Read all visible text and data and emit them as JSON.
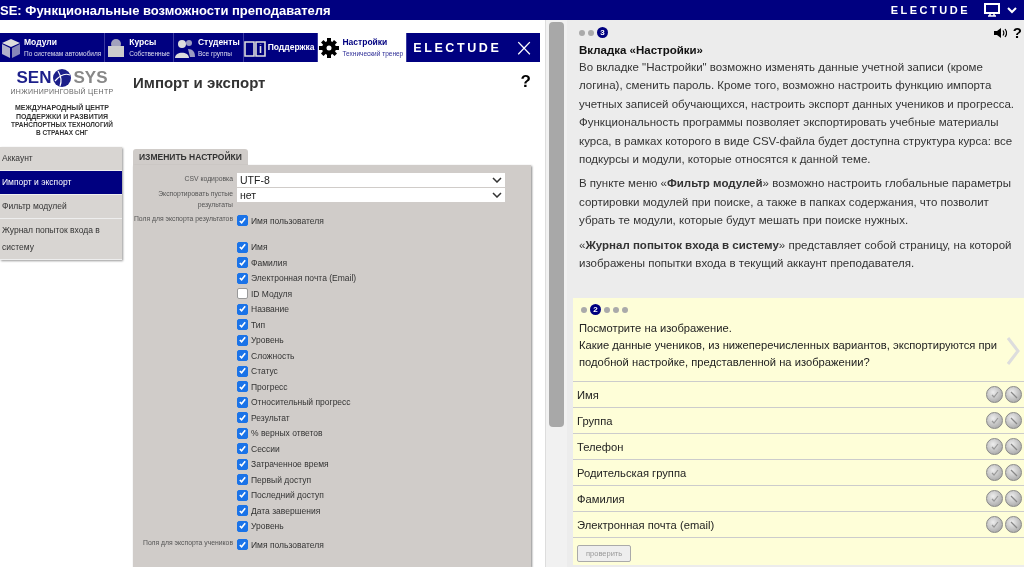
{
  "window": {
    "title": "SE: Функциональные возможности преподавателя",
    "brand": "ELECTUDE"
  },
  "nav": {
    "tabs": [
      {
        "label": "Модули",
        "sub": "По системам автомобиля",
        "selected": false
      },
      {
        "label": "Курсы",
        "sub": "Собственные",
        "selected": false
      },
      {
        "label": "Студенты",
        "sub": "Все группы",
        "selected": false
      },
      {
        "label": "Поддержка",
        "selected": false
      },
      {
        "label": "Настройки",
        "sub": "Технический тренер",
        "selected": true
      }
    ],
    "brand": "ELECTUDE",
    "close": "×"
  },
  "logo": {
    "left": "SEN",
    "right": "SYS",
    "tagline": "ИНЖИНИРИНГОВЫЙ ЦЕНТР",
    "caption": [
      "МЕЖДУНАРОДНЫЙ ЦЕНТР",
      "ПОДДЕРЖКИ И РАЗВИТИЯ",
      "ТРАНСПОРТНЫХ ТЕХНОЛОГИЙ",
      "В СТРАНАХ СНГ"
    ]
  },
  "page": {
    "heading": "Импорт и экспорт",
    "help": "?"
  },
  "side_menu": [
    {
      "label": "Аккаунт",
      "selected": false
    },
    {
      "label": "Импорт и экспорт",
      "selected": true
    },
    {
      "label": "Фильтр модулей",
      "selected": false
    },
    {
      "label": "Журнал попыток входа в систему",
      "selected": false
    }
  ],
  "settings": {
    "tab": "ИЗМЕНИТЬ НАСТРОЙКИ",
    "selects": [
      {
        "label": "CSV кодировка",
        "value": "UTF-8"
      },
      {
        "label": "Экспортировать пустые результаты",
        "value": "нет"
      }
    ],
    "groups": [
      {
        "label": "Поля для экспорта результатов",
        "fields": [
          {
            "label": "Имя пользователя",
            "checked": true
          },
          {
            "label": "Имя",
            "checked": true
          },
          {
            "label": "Фамилия",
            "checked": true
          },
          {
            "label": "Электронная почта (Email)",
            "checked": true
          },
          {
            "label": "ID Модуля",
            "checked": false
          },
          {
            "label": "Название",
            "checked": true
          },
          {
            "label": "Тип",
            "checked": true
          },
          {
            "label": "Уровень",
            "checked": true
          },
          {
            "label": "Сложность",
            "checked": true
          },
          {
            "label": "Статус",
            "checked": true
          },
          {
            "label": "Прогресс",
            "checked": true
          },
          {
            "label": "Относительный прогресс",
            "checked": true
          },
          {
            "label": "Результат",
            "checked": true
          },
          {
            "label": "% верных ответов",
            "checked": true
          },
          {
            "label": "Сессии",
            "checked": true
          },
          {
            "label": "Затраченное время",
            "checked": true
          },
          {
            "label": "Первый доступ",
            "checked": true
          },
          {
            "label": "Последний доступ",
            "checked": true
          },
          {
            "label": "Дата завершения",
            "checked": true
          },
          {
            "label": "Уровень",
            "checked": true
          }
        ]
      },
      {
        "label": "Поля для экспорта учеников",
        "fields": [
          {
            "label": "Имя пользователя",
            "checked": true
          }
        ]
      }
    ]
  },
  "lesson": {
    "steps": [
      {
        "selected": false
      },
      {
        "selected": false
      },
      {
        "selected": true,
        "label": "3"
      }
    ],
    "help": "?",
    "title": "Вкладка «Настройки»",
    "paragraphs": [
      "Во вкладке \"Настройки\" возможно изменять данные учетной записи (кроме логина), сменить пароль. Кроме того, возможно настроить функцию импорта учетных записей обучающихся, настроить экспорт данных учеников и прогресса. Функциональность программы позволяет экспортировать учебные материалы курса, в рамках которого в виде CSV-файла будет доступна структура курса: все подкурсы и модули, которые относятся к данной теме.",
      "В пункте меню «**Фильтр модулей**» возможно настроить глобальные параметры сортировки модулей при поиске, а также в папках содержания, что позволит убрать те модули, которые будут мешать при поиске нужных.",
      "«**Журнал попыток входа в систему**» представляет собой страницу, на которой изображены попытки входа в текущий аккаунт преподавателя."
    ]
  },
  "quiz": {
    "steps": [
      {
        "selected": false
      },
      {
        "selected": true,
        "label": "2"
      },
      {
        "selected": false
      },
      {
        "selected": false
      },
      {
        "selected": false
      }
    ],
    "question": [
      "Посмотрите на изображение.",
      "Какие данные учеников, из нижеперечисленных вариантов, экспортируются при подобной настройке, представленной на изображении?"
    ],
    "options": [
      {
        "label": "Имя",
        "tick_selected": false,
        "cross_selected": false
      },
      {
        "label": "Группа",
        "tick_selected": false,
        "cross_selected": false
      },
      {
        "label": "Телефон",
        "tick_selected": false,
        "cross_selected": false
      },
      {
        "label": "Родительская группа",
        "tick_selected": false,
        "cross_selected": false
      },
      {
        "label": "Фамилия",
        "tick_selected": false,
        "cross_selected": false
      },
      {
        "label": "Электронная почта (email)",
        "tick_selected": false,
        "cross_selected": false
      }
    ],
    "check_button": {
      "label": "проверить",
      "disabled": true
    }
  }
}
